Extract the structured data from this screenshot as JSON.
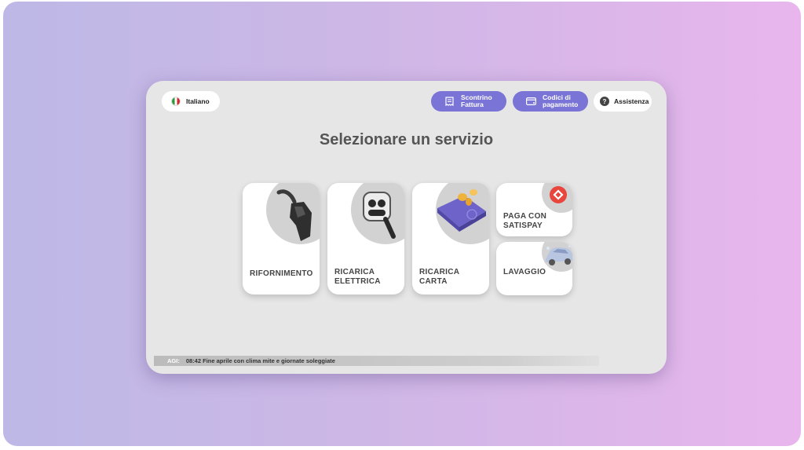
{
  "header": {
    "language_label": "Italiano",
    "receipt_label": "Scontrino\nFattura",
    "codes_label": "Codici di\npagamento",
    "help_label": "Assistenza",
    "help_glyph": "?"
  },
  "main": {
    "title": "Selezionare un servizio",
    "services": [
      {
        "label": "RIFORNIMENTO",
        "icon": "fuel-nozzle-icon"
      },
      {
        "label": "RICARICA\nELETTRICA",
        "icon": "ev-charger-icon"
      },
      {
        "label": "RICARICA\nCARTA",
        "icon": "card-coins-icon"
      },
      {
        "label": "PAGA CON\nSATISPAY",
        "icon": "satispay-logo-icon"
      },
      {
        "label": "LAVAGGIO",
        "icon": "car-wash-icon"
      }
    ]
  },
  "ticker": {
    "source": "AGI:",
    "message": "08:42 Fine aprile con clima mite e giornate soleggiate"
  },
  "colors": {
    "accent": "#7a74d6",
    "satispay": "#e8453c",
    "card_purple": "#6e63c9"
  }
}
